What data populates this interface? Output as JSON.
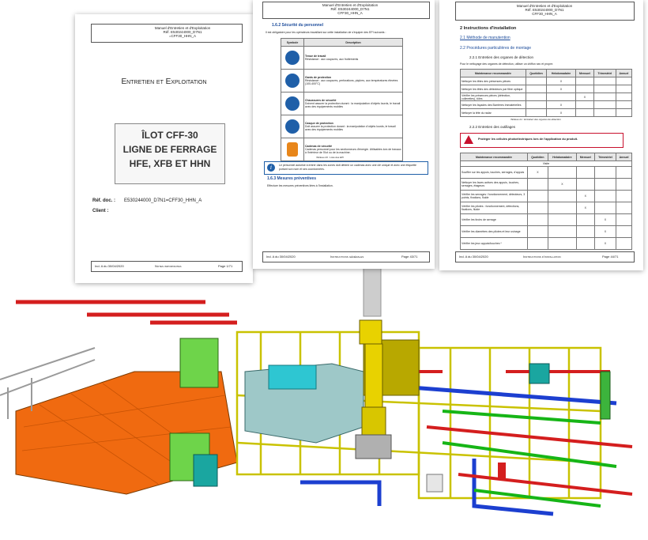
{
  "doc1": {
    "header": "Manuel d'Entretien et d'Exploitation\nRéf. E530244000_D7N1\n=CFF30_HHN_A",
    "section_title": "Entretien et Exploitation",
    "box_lines": [
      "ÎLOT CFF-30",
      "LIGNE DE FERRAGE",
      "HFE, XFB ET HHN"
    ],
    "ref_label": "Réf. doc. :",
    "ref_value": "E530244000_D7N1=CFF30_HHN_A",
    "client_label": "Client :",
    "footer_left": "Ind. A du 30/04/2020",
    "footer_mid": "Notes importantes",
    "footer_right": "Page 1/71"
  },
  "doc2": {
    "header": "Manuel d'Entretien et d'Exploitation\nRéf. E530244000_D7N1\nCFF30_HHN_A",
    "section": "1.6.2 Sécurité du personnel",
    "intro": "Il est obligatoire pour les opérateurs travaillant sur cette installation de s'équiper des EPI suivants :",
    "col_symbol": "Symbole",
    "col_desc": "Description",
    "rows": [
      {
        "title": "Tenue de travail",
        "body": "Résistance : aux coupures, aux frottements"
      },
      {
        "title": "Gants de protection",
        "body": "Résistance : aux coupures, perforations, piqûres, aux températures élevées (100-400°C)"
      },
      {
        "title": "Chaussures de sécurité",
        "body": "Doivent assurer la protection durant : la manipulation d'objets lourds, le travail avec des équipements mobiles"
      },
      {
        "title": "Casque de protection",
        "body": "Doit assurer la protection durant : la manipulation d'objets lourds, le travail avec des équipements mobiles"
      },
      {
        "title": "Cadenas de sécurité",
        "body": "Cadenas personnel pour les sectionneurs d'énergie. Utilisables lors de travaux à l'intérieur de l'îlot ou de la machine."
      }
    ],
    "caption": "Tableau 20 : Liste des EPI",
    "info": "Le personnel autorisé à entrer dans les zones doit détenir un cadenas avec une clé unique et avec une étiquette portant son nom et ses coordonnées.",
    "section2": "1.6.3 Mesures préventives",
    "section2_body": "Effectuer les mesures préventives liées à l'installation.",
    "footer_left": "Ind. A du 30/04/2020",
    "footer_mid": "Instructions générales",
    "footer_right": "Page 43/71"
  },
  "doc3": {
    "header": "Manuel d'Entretien et d'Exploitation\nRéf. E530244000_D7N1\nCFF30_HHN_A",
    "h1": "2 Instructions d'installation",
    "h2a": "2.1 Méthode de manutention",
    "h2b": "2.2 Procédures particulières de montage",
    "h3a": "2.2.1 Entretien des organes de détection",
    "p1": "Pour le nettoyage des organes de détection, utiliser un chiffon sec et propre.",
    "t1_headers": [
      "Maintenance recommandée",
      "Quotidien",
      "Hebdomadaire",
      "Mensuel",
      "Trimestriel",
      "Annuel"
    ],
    "t1_rows": [
      [
        "Nettoyer les têtes des présences pièces",
        "",
        "X",
        "",
        "",
        ""
      ],
      [
        "Nettoyer les têtes des détecteurs par fibre optique",
        "",
        "X",
        "",
        "",
        ""
      ],
      [
        "Vérifier les présences pièces (détection, collerettes), tôles",
        "",
        "",
        "X",
        "",
        ""
      ],
      [
        "Nettoyer les façades des Barrières Immatérielles",
        "",
        "X",
        "",
        "",
        ""
      ],
      [
        "Nettoyer la tête du radar",
        "",
        "X",
        "",
        "",
        ""
      ]
    ],
    "caption1": "Tableau 21 : Entretien des organes de détection",
    "h3b": "2.2.2 Entretien des outillages",
    "warning": "Protéger les cellules photoélectriques lors de l'application du produit.",
    "t2_headers": [
      "Maintenance recommandée",
      "Quotidien",
      "Hebdomadaire",
      "Mensuel",
      "Trimestriel",
      "Annuel"
    ],
    "t2_group": "Visite",
    "t2_rows": [
      [
        "Souffler sur les appuis, touches, serrages, d'appuis",
        "X",
        "",
        "",
        "",
        ""
      ],
      [
        "Nettoyer les faces actives des appuis, touches, serrages, étageurs",
        "",
        "X",
        "",
        "",
        ""
      ],
      [
        "Vérifier les serrages / fonctionnement, détecteurs, 3 points, fixations, fluide",
        "",
        "",
        "X",
        "",
        ""
      ],
      [
        "Vérifier les pilotes : fonctionnement, détections, fixations, fluide",
        "",
        "",
        "X",
        "",
        ""
      ],
      [
        "Vérifier les tiroirs de serrage",
        "",
        "",
        "",
        "X",
        ""
      ],
      [
        "Vérifier les diamètres des pilotes et leur usinage",
        "",
        "",
        "",
        "X",
        ""
      ],
      [
        "Vérifier les jeux appuis/touches *",
        "",
        "",
        "",
        "X",
        ""
      ]
    ],
    "footer_left": "Ind. A du 30/04/2020",
    "footer_mid": "Instructions d'installation",
    "footer_right": "Page 44/71"
  },
  "colors": {
    "frame_yellow": "#c9c200",
    "floor_orange": "#f06a10",
    "pipe_red": "#d41e1e",
    "pipe_blue": "#1c3fd0",
    "pipe_green": "#16b516",
    "robot_yellow": "#e8d200",
    "cabinet_green": "#6ed44a",
    "teal": "#1aa6a0",
    "heading_blue": "#1a4a9a",
    "warning_red": "#c8102e"
  }
}
